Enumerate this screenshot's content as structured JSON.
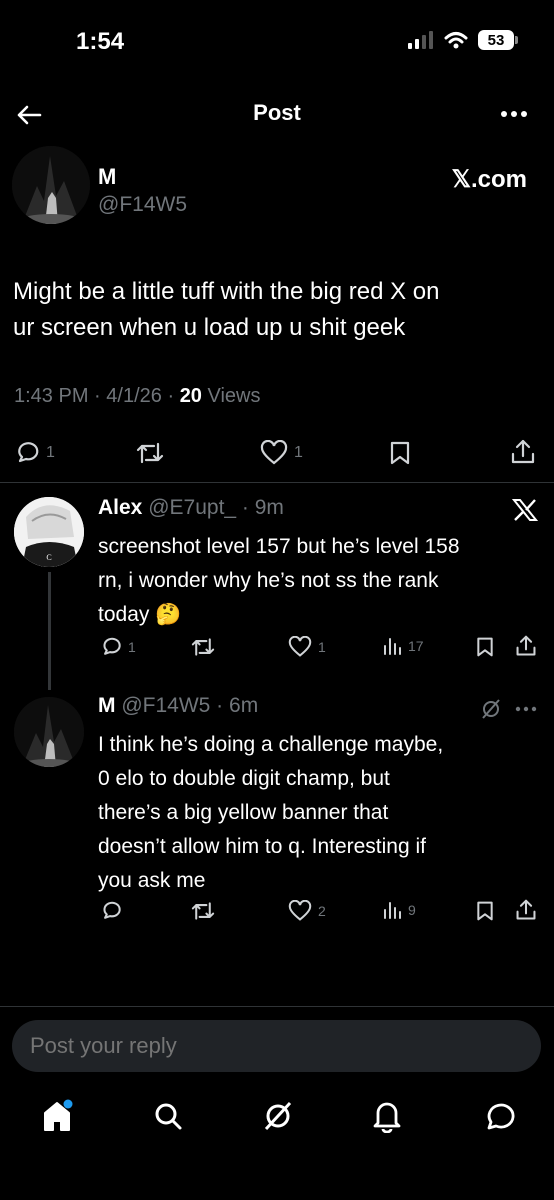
{
  "status_bar": {
    "time": "1:54",
    "battery": "53"
  },
  "header": {
    "title": "Post"
  },
  "post": {
    "author_name": "M",
    "author_handle": "@F14W5",
    "source_label": "𝕏.com",
    "text_line1": "Might be a little tuff with the big red X on",
    "text_line2": "ur screen when u load up u shit geek",
    "time": "1:43 PM",
    "date": "4/1/26",
    "views_count": "20",
    "views_label": "Views",
    "sep": "·",
    "reply_count": "1",
    "like_count": "1"
  },
  "replies": [
    {
      "author_name": "Alex",
      "handle_time": "@E7upt_ · 9m",
      "lines": [
        "screenshot level 157 but he’s level 158",
        "rn, i wonder why he’s not ss the rank",
        "today 🤔"
      ],
      "reply_count": "1",
      "like_count": "1",
      "views": "17"
    },
    {
      "author_name": "M",
      "handle_time": "@F14W5 · 6m",
      "lines": [
        "I think he’s doing a challenge maybe,",
        "0 elo to double digit champ, but",
        "there’s a big yellow banner that",
        "doesn’t allow him to q. Interesting if",
        "you ask me"
      ],
      "reply_count": "",
      "like_count": "2",
      "views": "9"
    }
  ],
  "composer": {
    "placeholder": "Post your reply"
  },
  "icons": {
    "back": "arrow-left-icon",
    "more": "more-dots-icon",
    "reply": "reply-icon",
    "repost": "repost-icon",
    "like": "heart-icon",
    "bookmark": "bookmark-icon",
    "share": "share-icon",
    "views": "views-icon",
    "home": "home-icon",
    "search": "search-icon",
    "grok": "grok-icon",
    "notifications": "bell-icon",
    "messages": "messages-icon"
  },
  "colors": {
    "background": "#000000",
    "text": "#e7e9ea",
    "muted": "#71767b",
    "accent": "#1d9bf0"
  }
}
